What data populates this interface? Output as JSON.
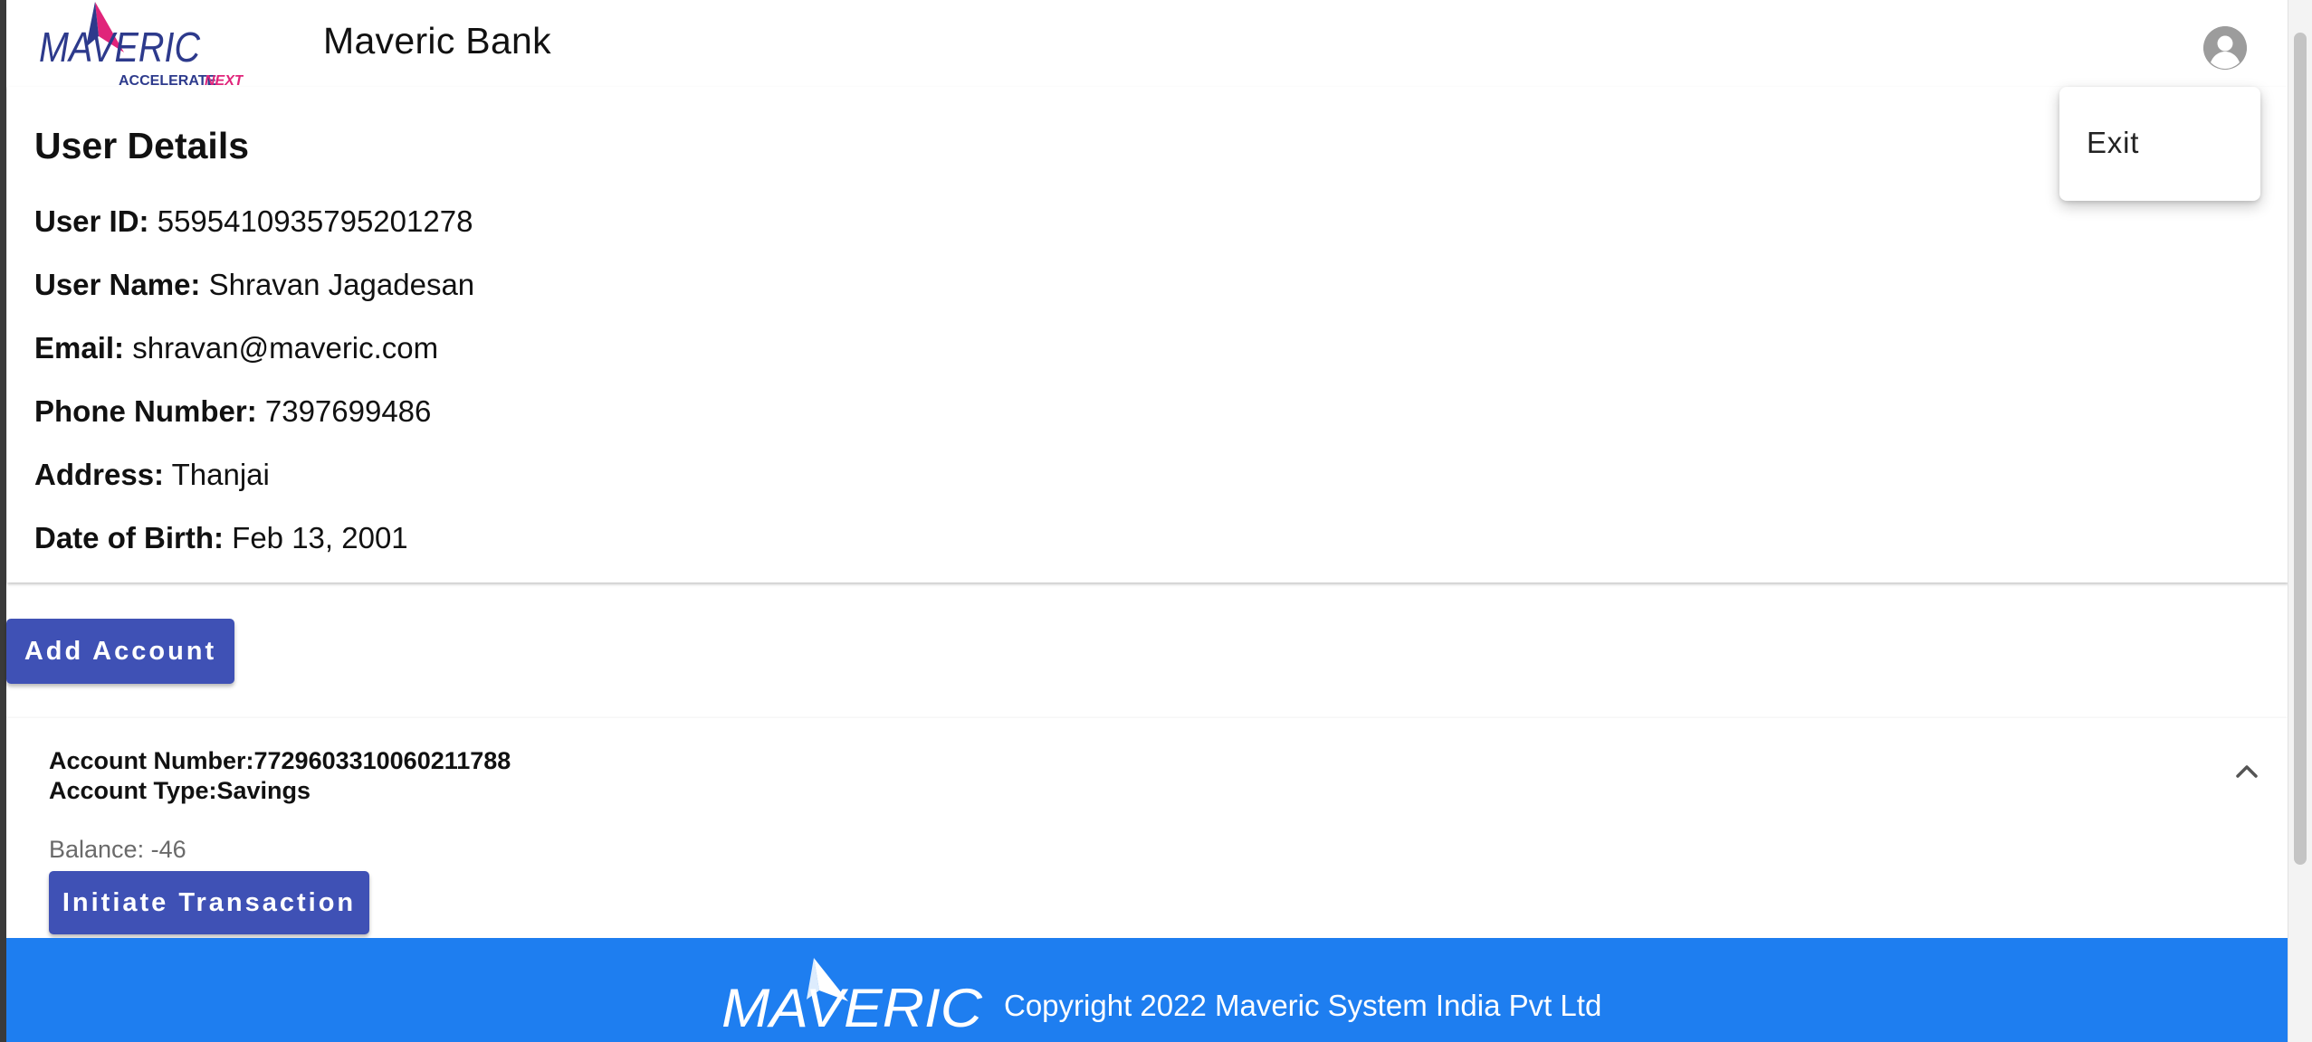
{
  "header": {
    "logo_text": "MAVERIC",
    "logo_tagline_1": "ACCELERATE",
    "logo_tagline_2": "NEXT",
    "title": "Maveric Bank",
    "avatar_icon": "account-circle-icon"
  },
  "user_menu": {
    "items": [
      {
        "label": "Exit"
      }
    ]
  },
  "user_details": {
    "title": "User Details",
    "fields": [
      {
        "label": "User ID:",
        "value": "5595410935795201278"
      },
      {
        "label": "User Name:",
        "value": "Shravan Jagadesan"
      },
      {
        "label": "Email:",
        "value": "shravan@maveric.com"
      },
      {
        "label": "Phone Number:",
        "value": "7397699486"
      },
      {
        "label": "Address:",
        "value": "Thanjai"
      },
      {
        "label": "Date of Birth:",
        "value": "Feb 13, 2001"
      }
    ]
  },
  "actions": {
    "add_account_label": "Add Account"
  },
  "accounts": [
    {
      "number_line": "Account Number:7729603310060211788",
      "type_line": "Account Type:Savings",
      "balance_line": "Balance: -46",
      "initiate_label": "Initiate Transaction",
      "expand_icon": "chevron-up-icon"
    }
  ],
  "footer": {
    "logo_text": "MAVERIC",
    "copyright": "Copyright 2022 Maveric System India Pvt Ltd"
  },
  "colors": {
    "primary_button": "#3f51b5",
    "footer_background": "#1e7ef0",
    "logo_blue": "#2d3a8c",
    "logo_pink": "#e0247a"
  }
}
